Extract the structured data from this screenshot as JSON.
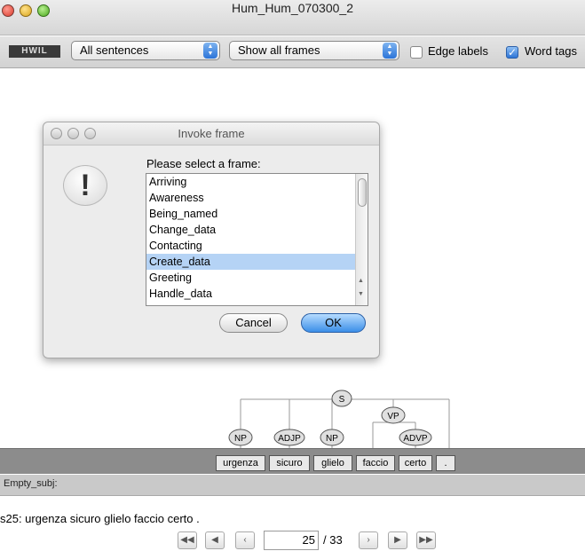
{
  "window": {
    "title": "Hum_Hum_070300_2"
  },
  "toolbar": {
    "logo_text": "HWIL",
    "sentence_filter": "All sentences",
    "frame_filter": "Show all frames",
    "edge_labels": {
      "label": "Edge labels",
      "checked": false
    },
    "word_tags": {
      "label": "Word tags",
      "checked": true
    }
  },
  "dialog": {
    "title": "Invoke frame",
    "icon": "exclamation-alert-icon",
    "prompt": "Please select a frame:",
    "frames": [
      "Arriving",
      "Awareness",
      "Being_named",
      "Change_data",
      "Contacting",
      "Create_data",
      "Greeting",
      "Handle_data"
    ],
    "selected": "Create_data",
    "cancel_label": "Cancel",
    "ok_label": "OK"
  },
  "tree": {
    "root": "S",
    "phrases": [
      "NP",
      "ADJP",
      "NP",
      "VP",
      "ADVP"
    ],
    "words": [
      "urgenza",
      "sicuro",
      "glielo",
      "faccio",
      "certo",
      "."
    ]
  },
  "slots": {
    "label": "Empty_subj:"
  },
  "sentence": {
    "text": "s25: urgenza sicuro glielo faccio certo ."
  },
  "navigation": {
    "current": "25",
    "total": "/ 33"
  }
}
